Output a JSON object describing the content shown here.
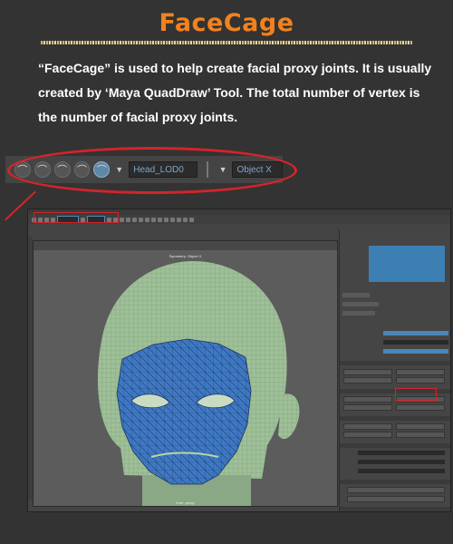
{
  "title": "FaceCage",
  "description": "“FaceCage” is used to help create facial proxy joints. It is usually created by ‘Maya QuadDraw’ Tool. The total number of vertex is the number of facial proxy joints.",
  "toolbar": {
    "icons": [
      "magnet-snap-icon",
      "magnet-snap-icon",
      "magnet-snap-icon",
      "magnet-snap-icon",
      "magnet-snap-icon"
    ],
    "active_index": 4,
    "object_field": "Head_LOD0",
    "axis_field": "Object X"
  },
  "viewport": {
    "title": "Symmetry: Object X",
    "camera": "front -persp"
  },
  "colors": {
    "title": "#f1821e",
    "highlight": "#d1252b",
    "mesh_blue": "#3f78c2",
    "head_green": "#9fbf98"
  }
}
